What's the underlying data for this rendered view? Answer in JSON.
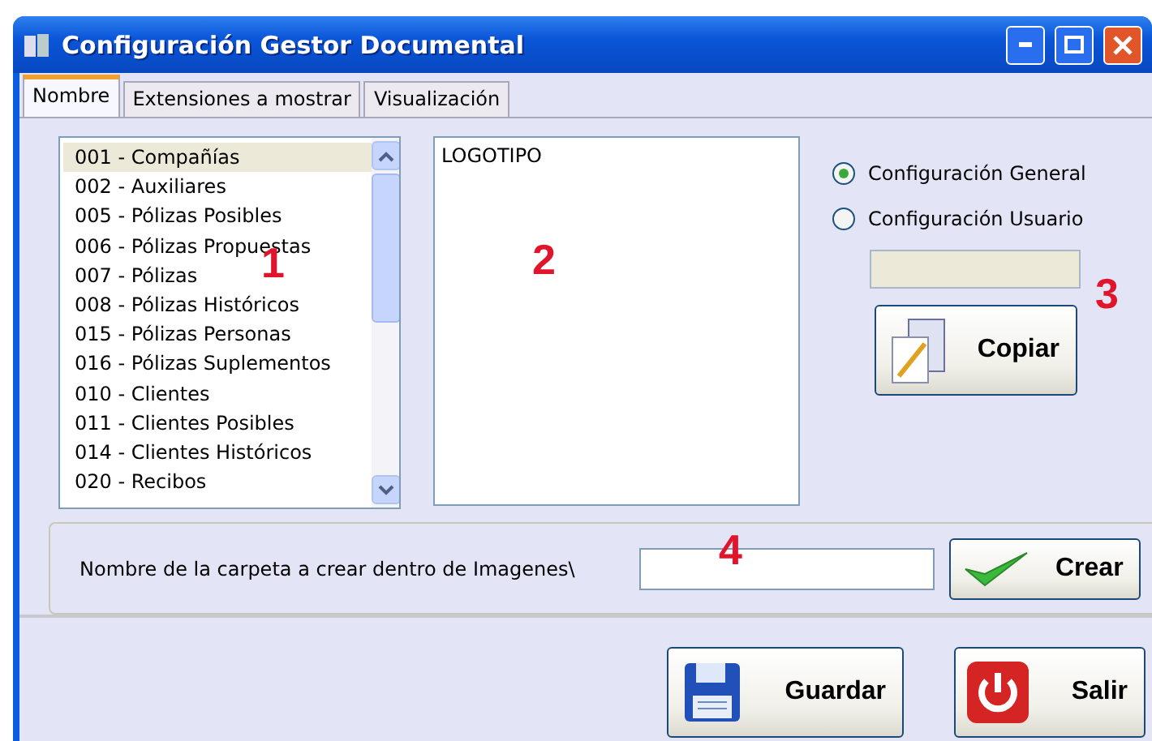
{
  "window": {
    "title": "Configuración Gestor Documental"
  },
  "tabs": [
    {
      "label": "Nombre",
      "selected": true
    },
    {
      "label": "Extensiones a mostrar",
      "selected": false
    },
    {
      "label": "Visualización",
      "selected": false
    }
  ],
  "list": {
    "items": [
      {
        "label": "001 - Compañías",
        "selected": true
      },
      {
        "label": "002 - Auxiliares",
        "selected": false
      },
      {
        "label": "005 - Pólizas Posibles",
        "selected": false
      },
      {
        "label": "006 - Pólizas Propuestas",
        "selected": false
      },
      {
        "label": "007 - Pólizas",
        "selected": false
      },
      {
        "label": "008 - Pólizas Históricos",
        "selected": false
      },
      {
        "label": "015 - Pólizas Personas",
        "selected": false
      },
      {
        "label": "016 - Pólizas Suplementos",
        "selected": false
      },
      {
        "label": "010 - Clientes",
        "selected": false
      },
      {
        "label": "011 - Clientes Posibles",
        "selected": false
      },
      {
        "label": "014 - Clientes Históricos",
        "selected": false
      },
      {
        "label": "020 - Recibos",
        "selected": false
      }
    ]
  },
  "text_area": {
    "value": "LOGOTIPO"
  },
  "radios": [
    {
      "label": "Configuración General",
      "selected": true
    },
    {
      "label": "Configuración Usuario",
      "selected": false
    }
  ],
  "user_field": {
    "disabled": true
  },
  "copy_button": {
    "label": "Copiar"
  },
  "folder": {
    "label": "Nombre de la carpeta a crear dentro de Imagenes\\",
    "create_button": "Crear"
  },
  "buttons": [
    {
      "kind": "save",
      "label": "Guardar"
    },
    {
      "kind": "exit",
      "label": "Salir"
    }
  ],
  "annotations": [
    "1",
    "2",
    "3",
    "4"
  ]
}
